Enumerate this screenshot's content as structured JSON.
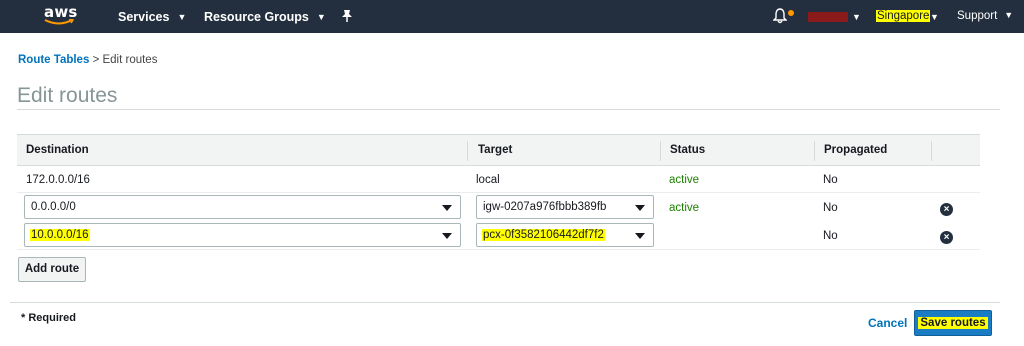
{
  "nav": {
    "logo": "aws",
    "services": "Services",
    "resource_groups": "Resource Groups",
    "region": "Singapore",
    "support": "Support"
  },
  "breadcrumb": {
    "link": "Route Tables",
    "separator": ">",
    "current": "Edit routes"
  },
  "page_title": "Edit routes",
  "table": {
    "headers": [
      "Destination",
      "Target",
      "Status",
      "Propagated"
    ],
    "rows": [
      {
        "destination": "172.0.0.0/16",
        "target": "local",
        "status": "active",
        "propagated": "No"
      },
      {
        "destination": "0.0.0.0/0",
        "target": "igw-0207a976fbbb389fb",
        "status": "active",
        "propagated": "No"
      },
      {
        "destination": "10.0.0.0/16",
        "target": "pcx-0f3582106442df7f2",
        "status": "",
        "propagated": "No"
      }
    ]
  },
  "buttons": {
    "add_route": "Add route",
    "cancel": "Cancel",
    "save_routes": "Save routes"
  },
  "required_note": "* Required",
  "colors": {
    "nav_bg": "#232f3e",
    "link": "#0073bb",
    "active": "#1d8102",
    "primary": "#1a7dc4",
    "highlight": "#ffff00"
  }
}
